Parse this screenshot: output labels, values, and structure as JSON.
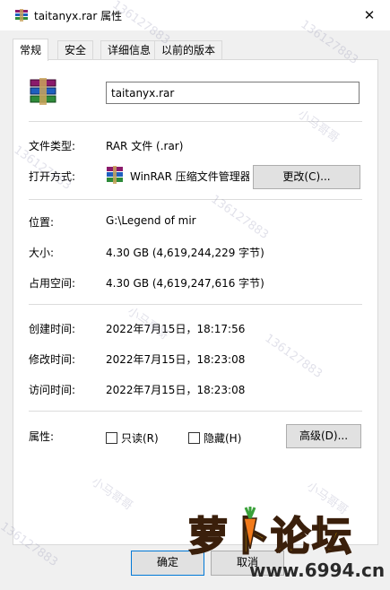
{
  "window": {
    "title": "taitanyx.rar 属性",
    "close_glyph": "✕"
  },
  "tabs": [
    "常规",
    "安全",
    "详细信息",
    "以前的版本"
  ],
  "general": {
    "file_name": "taitanyx.rar",
    "file_type_label": "文件类型:",
    "file_type_value": "RAR 文件 (.rar)",
    "open_with_label": "打开方式:",
    "open_with_value": "WinRAR 压缩文件管理器",
    "change_button": "更改(C)...",
    "location_label": "位置:",
    "location_value": "G:\\Legend of mir",
    "size_label": "大小:",
    "size_value": "4.30 GB (4,619,244,229 字节)",
    "size_on_disk_label": "占用空间:",
    "size_on_disk_value": "4.30 GB (4,619,247,616 字节)",
    "created_label": "创建时间:",
    "created_value": "2022年7月15日，18:17:56",
    "modified_label": "修改时间:",
    "modified_value": "2022年7月15日，18:23:08",
    "accessed_label": "访问时间:",
    "accessed_value": "2022年7月15日，18:23:08",
    "attributes_label": "属性:",
    "readonly_label": "只读(R)",
    "readonly_checked": false,
    "hidden_label": "隐藏(H)",
    "hidden_checked": false,
    "advanced_button": "高级(D)..."
  },
  "footer": {
    "ok_button": "确定",
    "cancel_button_partial": "取消"
  },
  "watermark": {
    "brand_text": "萝卜论坛",
    "url_text": "www.6994.cn",
    "overlay_texts": [
      "小马哥哥",
      "136127883"
    ]
  },
  "colors": {
    "accent_logo": "#f7c400",
    "panel_bg": "#ffffff",
    "window_bg": "#f0f0f0"
  }
}
